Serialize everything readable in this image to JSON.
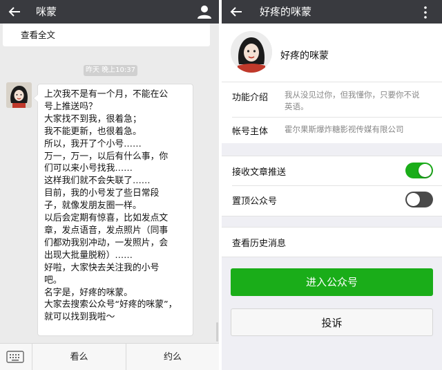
{
  "left_screen": {
    "title": "咪蒙",
    "read_full_text": "查看全文",
    "timestamp": "昨天 晚上10:37",
    "message_lines": [
      "上次我不是有一个月，不能在公",
      "号上推送吗？",
      "大家找不到我，很着急；",
      "我不能更新，也很着急。",
      "所以，我开了个小号……",
      "万一，万一，以后有什么事，你",
      "们可以来小号找我……",
      "这样我们就不会失联了……",
      "目前，我的小号发了些日常段",
      "子，就像发朋友圈一样。",
      "以后会定期有惊喜，比如发点文",
      "章，发点语音，发点照片（同事",
      "们都劝我别冲动，一发照片，会",
      "出现大批量脱粉）……",
      "好啦，大家快去关注我的小号",
      "吧。",
      "名字是，好疼的咪蒙。",
      "大家去搜索公众号“好疼的咪蒙”，",
      "就可以找到我啦～"
    ],
    "bottom_menu": [
      "看么",
      "约么"
    ]
  },
  "right_screen": {
    "title": "好疼的咪蒙",
    "profile_name": "好疼的咪蒙",
    "intro_label": "功能介绍",
    "intro_value_lines": [
      "我从没见过你，但我懂你，只要你不说",
      "英语。"
    ],
    "owner_label": "帐号主体",
    "owner_value": "霍尔果斯爆炸糖影视传媒有限公司",
    "receive_push_label": "接收文章推送",
    "receive_push_on": true,
    "pin_top_label": "置顶公众号",
    "pin_top_on": false,
    "history_label": "查看历史消息",
    "enter_button": "进入公众号",
    "complain_button": "投诉"
  },
  "colors": {
    "topbar": "#393a3f",
    "accent_green": "#1aad19",
    "toggle_on": "#1aad19",
    "toggle_off": "#4a4a4a"
  }
}
